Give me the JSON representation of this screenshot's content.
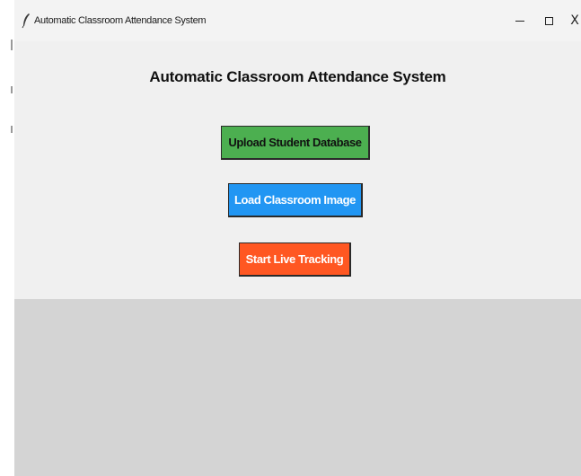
{
  "window": {
    "title": "Automatic Classroom Attendance System",
    "controls": {
      "minimize_icon": "minimize-icon",
      "maximize_icon": "maximize-icon",
      "close_glyph": "X"
    },
    "app_icon": "feather-icon"
  },
  "main": {
    "heading": "Automatic Classroom Attendance System",
    "buttons": [
      {
        "label": "Upload Student Database",
        "color": "#4caf50"
      },
      {
        "label": "Load Classroom Image",
        "color": "#2196f3"
      },
      {
        "label": "Start Live Tracking",
        "color": "#ff5722"
      }
    ]
  },
  "colors": {
    "window_bg": "#f0f0f0",
    "lower_area_bg": "#d4d4d4"
  }
}
